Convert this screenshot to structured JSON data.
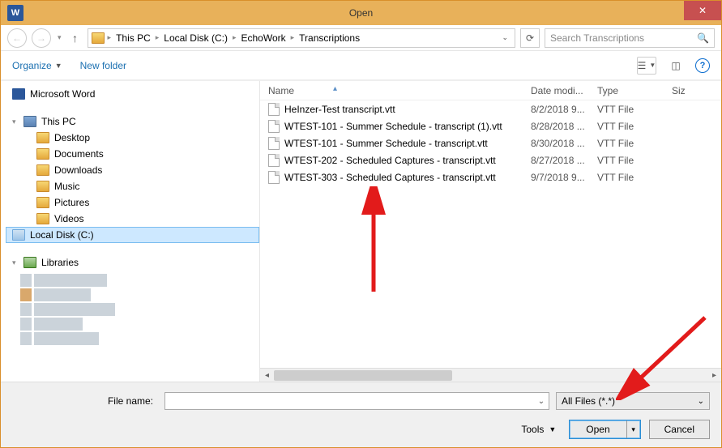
{
  "window": {
    "title": "Open"
  },
  "breadcrumb": {
    "items": [
      "This PC",
      "Local Disk (C:)",
      "EchoWork",
      "Transcriptions"
    ]
  },
  "search": {
    "placeholder": "Search Transcriptions"
  },
  "toolbar": {
    "organize": "Organize",
    "newfolder": "New folder"
  },
  "tree": {
    "word": "Microsoft Word",
    "thispc": "This PC",
    "children": [
      "Desktop",
      "Documents",
      "Downloads",
      "Music",
      "Pictures",
      "Videos",
      "Local Disk (C:)"
    ],
    "libraries": "Libraries"
  },
  "columns": {
    "name": "Name",
    "date": "Date modi...",
    "type": "Type",
    "size": "Siz"
  },
  "files": [
    {
      "name": "HeInzer-Test transcript.vtt",
      "date": "8/2/2018 9...",
      "type": "VTT File"
    },
    {
      "name": "WTEST-101 - Summer Schedule - transcript (1).vtt",
      "date": "8/28/2018 ...",
      "type": "VTT File"
    },
    {
      "name": "WTEST-101 - Summer Schedule - transcript.vtt",
      "date": "8/30/2018 ...",
      "type": "VTT File"
    },
    {
      "name": "WTEST-202 - Scheduled Captures - transcript.vtt",
      "date": "8/27/2018 ...",
      "type": "VTT File"
    },
    {
      "name": "WTEST-303 - Scheduled Captures - transcript.vtt",
      "date": "9/7/2018 9...",
      "type": "VTT File"
    }
  ],
  "footer": {
    "filename_label": "File name:",
    "filter": "All Files (*.*)",
    "tools": "Tools",
    "open": "Open",
    "cancel": "Cancel"
  }
}
